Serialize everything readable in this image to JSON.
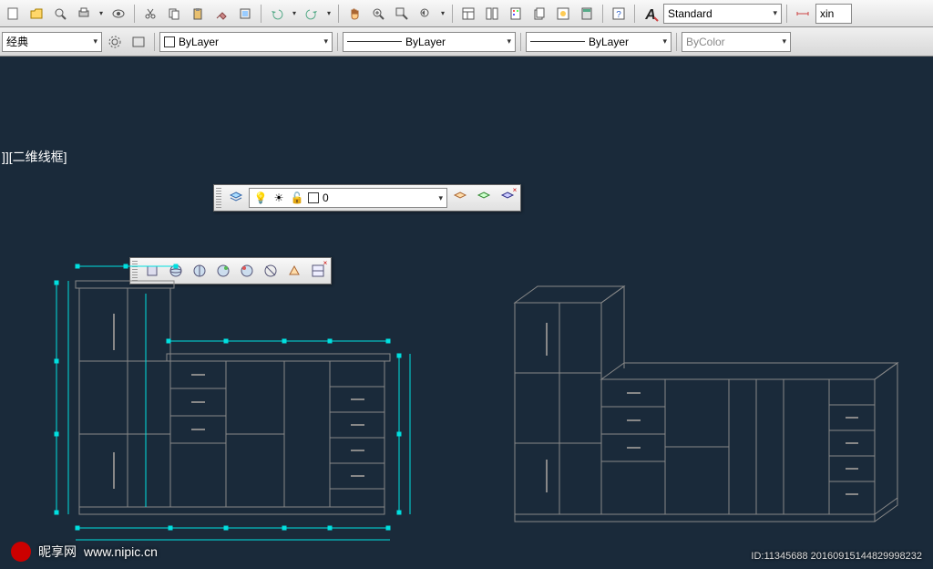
{
  "view_label": "]][二维线框]",
  "toolbar1": {
    "text_style": "Standard",
    "last": "xin"
  },
  "toolbar2": {
    "style": "经典",
    "layer_color": "ByLayer",
    "linetype": "ByLayer",
    "lineweight": "ByLayer",
    "plot_style": "ByColor"
  },
  "layers_float": {
    "current": "0"
  },
  "watermark": {
    "site_name": "昵享网",
    "site_url": "www.nipic.cn",
    "id_line": "ID:11345688 20160915144829998232"
  }
}
